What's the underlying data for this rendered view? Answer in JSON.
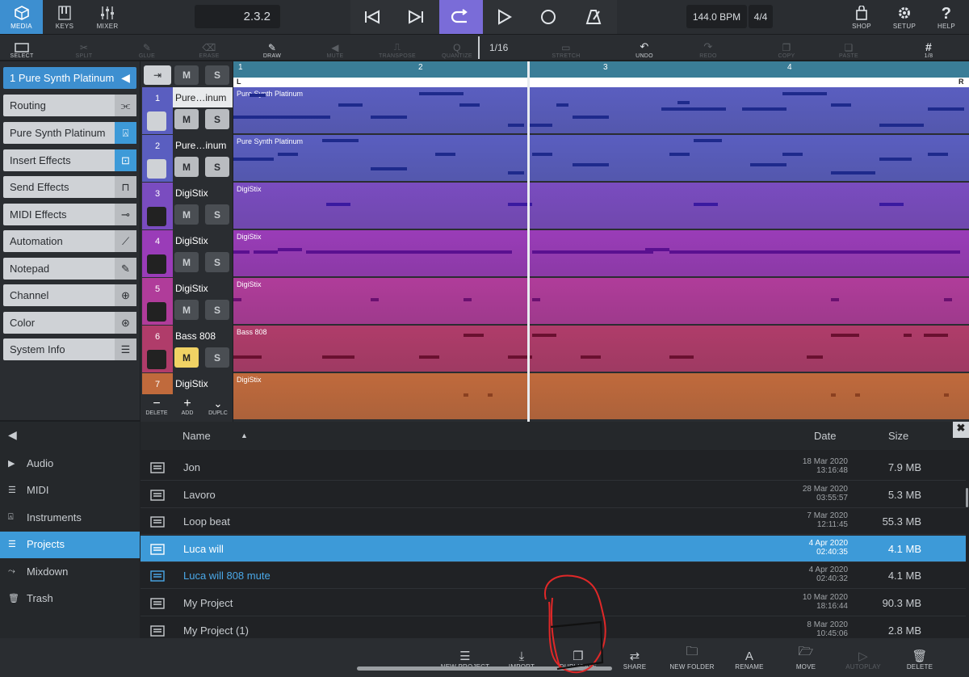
{
  "colors": {
    "accent": "#3d8fd0",
    "loop": "#7a6cd8",
    "mute_active": "#f0d264"
  },
  "top": {
    "media": "MEDIA",
    "keys": "KEYS",
    "mixer": "MIXER",
    "position": "2.3.2",
    "bpm": "144.0 BPM",
    "signature": "4/4",
    "shop": "SHOP",
    "setup": "SETUP",
    "help": "HELP"
  },
  "tools": {
    "select": "SELECT",
    "split": "SPLIT",
    "glue": "GLUE",
    "erase": "ERASE",
    "draw": "DRAW",
    "mute": "MUTE",
    "transpose": "TRANSPOSE",
    "quantize": "QUANTIZE",
    "quant_value": "1/16",
    "stretch": "STRETCH",
    "undo": "UNDO",
    "redo": "REDO",
    "copy": "COPY",
    "paste": "PASTE",
    "grid": "1/8"
  },
  "inspector": {
    "track": "1  Pure Synth Platinum",
    "items": [
      "Routing",
      "Pure Synth Platinum",
      "Insert Effects",
      "Send Effects",
      "MIDI Effects",
      "Automation",
      "Notepad",
      "Channel",
      "Color",
      "System Info"
    ]
  },
  "tracks": [
    {
      "num": "1",
      "name": "Pure…inum",
      "lane": "Pure Synth Platinum",
      "color": "#5a5ec0"
    },
    {
      "num": "2",
      "name": "Pure…inum",
      "lane": "Pure Synth Platinum",
      "color": "#5a5ec0"
    },
    {
      "num": "3",
      "name": "DigiStix",
      "lane": "DigiStix",
      "color": "#7a4cc0"
    },
    {
      "num": "4",
      "name": "DigiStix",
      "lane": "DigiStix",
      "color": "#9a3cb8"
    },
    {
      "num": "5",
      "name": "DigiStix",
      "lane": "DigiStix",
      "color": "#b03c9a"
    },
    {
      "num": "6",
      "name": "Bass 808",
      "lane": "Bass 808",
      "color": "#b03c6a"
    },
    {
      "num": "7",
      "name": "DigiStix",
      "lane": "DigiStix",
      "color": "#c06a3c"
    }
  ],
  "track_controls": {
    "mute": "M",
    "solo": "S",
    "delete": "DELETE",
    "add": "ADD",
    "duplicate": "DUPLC"
  },
  "ruler": {
    "bars": [
      "1",
      "2",
      "3",
      "4"
    ],
    "left": "L",
    "right": "R"
  },
  "browser": {
    "categories": [
      "Audio",
      "MIDI",
      "Instruments",
      "Projects",
      "Mixdown",
      "Trash"
    ],
    "selected_category": "Projects",
    "headers": {
      "name": "Name",
      "date": "Date",
      "size": "Size"
    },
    "rows": [
      {
        "name": "Jon",
        "date": "18 Mar 2020",
        "time": "13:16:48",
        "size": "7.9 MB"
      },
      {
        "name": "Lavoro",
        "date": "28 Mar 2020",
        "time": "03:55:57",
        "size": "5.3 MB"
      },
      {
        "name": "Loop beat",
        "date": "7 Mar 2020",
        "time": "12:11:45",
        "size": "55.3 MB"
      },
      {
        "name": "Luca will",
        "date": "4 Apr 2020",
        "time": "02:40:35",
        "size": "4.1 MB"
      },
      {
        "name": "Luca will  808 mute",
        "date": "4 Apr 2020",
        "time": "02:40:32",
        "size": "4.1 MB"
      },
      {
        "name": "My Project",
        "date": "10 Mar 2020",
        "time": "18:16:44",
        "size": "90.3 MB"
      },
      {
        "name": "My Project (1)",
        "date": "8 Mar 2020",
        "time": "10:45:06",
        "size": "2.8 MB"
      }
    ]
  },
  "bottom": {
    "new_project": "NEW PROJECT",
    "import": "IMPORT",
    "duplicate": "DUPLICATE",
    "share": "SHARE",
    "new_folder": "NEW FOLDER",
    "rename": "RENAME",
    "move": "MOVE",
    "autoplay": "AUTOPLAY",
    "delete": "DELETE"
  }
}
